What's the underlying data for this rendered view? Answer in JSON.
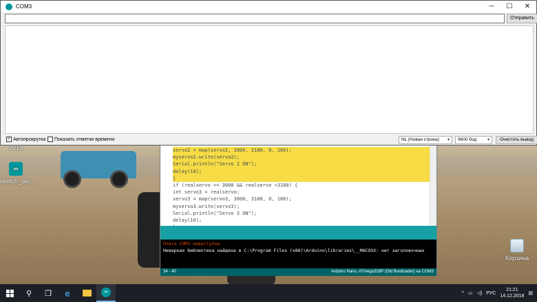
{
  "serial_monitor": {
    "title": "COM3",
    "send_input_value": "",
    "send_button": "Отправить",
    "autoscroll_label": "Автопрокрутка",
    "autoscroll_checked": true,
    "timestamps_label": "Показать отметки времени",
    "timestamps_checked": false,
    "line_ending": "NL (Новая строка)",
    "baud_rate": "9600 бод",
    "clear_button": "Очистить вывод"
  },
  "ide": {
    "code_lines": [
      {
        "text": "servo2 = map(servo2, 2000, 2180, 0, 180);",
        "highlighted": true
      },
      {
        "text": "myservo2.write(servo2);",
        "highlighted": true
      },
      {
        "text": "Serial.println(\"Servo 2 ON\");",
        "highlighted": true
      },
      {
        "text": "delay(10);",
        "highlighted": true
      },
      {
        "text": "}",
        "highlighted": true
      },
      {
        "text": "if (realservo >= 3000 && realservo <3180) {",
        "highlighted": false
      },
      {
        "text": "int servo3 = realservo;",
        "highlighted": false
      },
      {
        "text": "servo3 = map(servo3, 3000, 3180, 0, 180);",
        "highlighted": false
      },
      {
        "text": "myservo3.write(servo3);",
        "highlighted": false
      },
      {
        "text": "Serial.println(\"Servo 3 ON\");",
        "highlighted": false
      },
      {
        "text": "delay(10);",
        "highlighted": false
      },
      {
        "text": "}",
        "highlighted": false
      }
    ],
    "console_error": "Плата COM3 недоступна",
    "console_message": "Неверная библиотека найдена в C:\\Program Files (x86)\\Arduino\\libraries\\__MACOSX: нет заголовочных",
    "status_line": "34 - 40",
    "status_board": "Arduino Nano, ATmega328P (Old Bootloader) на COM3"
  },
  "desktop": {
    "icons": [
      {
        "name": "arduino-sketch-icon",
        "label": "sketch_dec..."
      },
      {
        "name": "recycle-bin-icon",
        "label": "Корзина"
      }
    ],
    "partial_label": "2018"
  },
  "taskbar": {
    "language": "РУС",
    "time": "21:21",
    "date": "14.12.2018"
  },
  "colors": {
    "arduino_teal": "#00979c",
    "highlight_yellow": "#f7dc45",
    "console_bg": "#000000",
    "taskbar_bg": "#1c1f26"
  }
}
